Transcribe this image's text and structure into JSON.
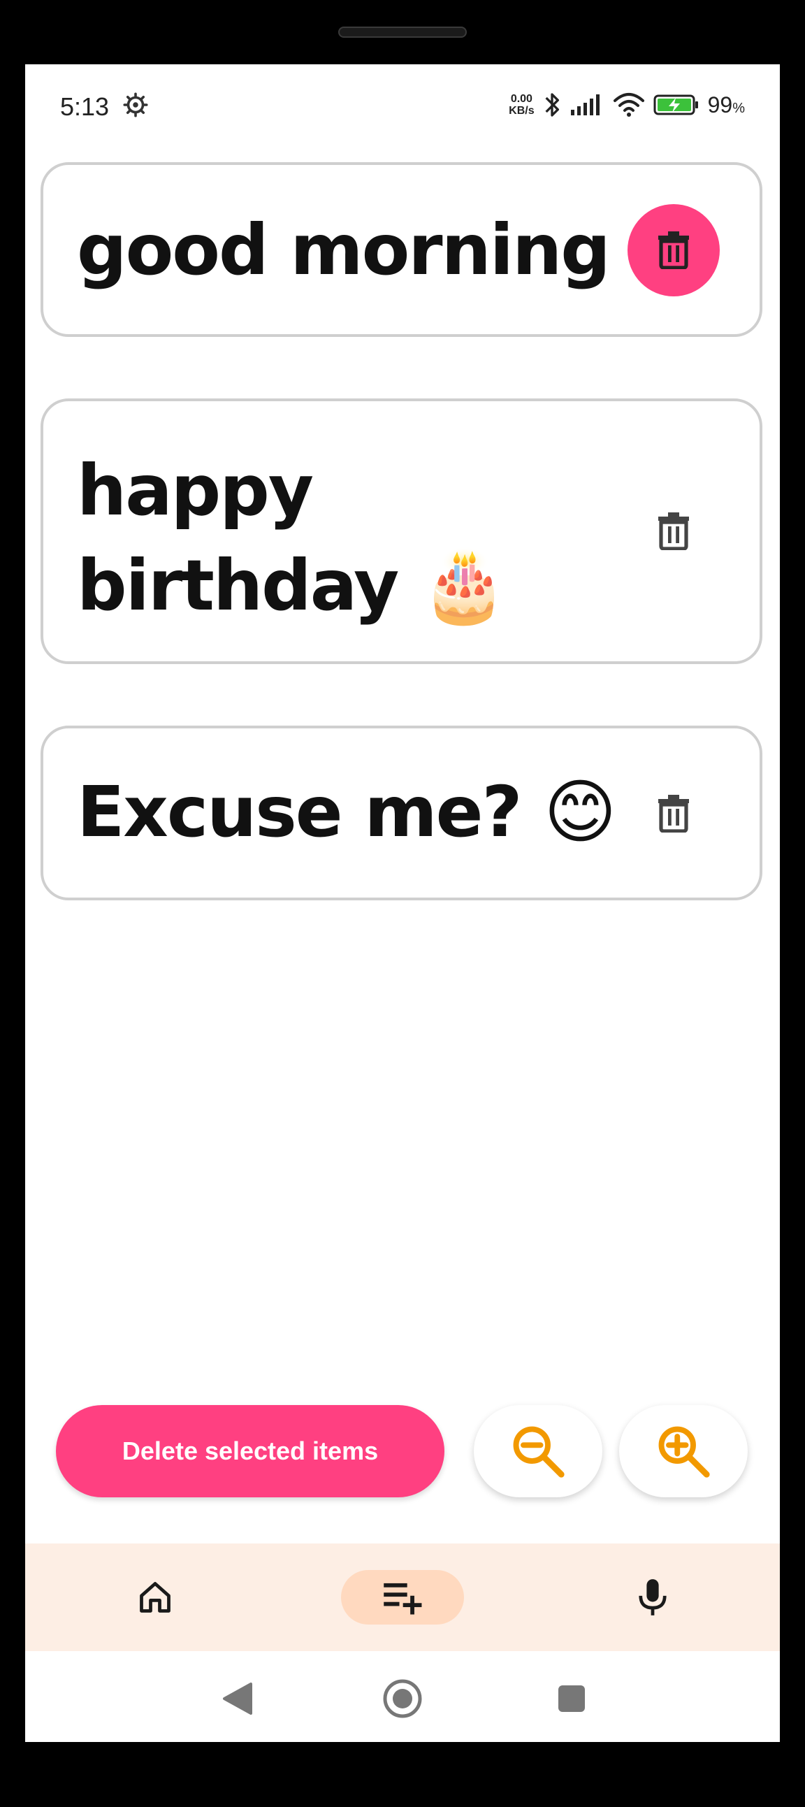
{
  "status_bar": {
    "time": "5:13",
    "net_speed_value": "0.00",
    "net_speed_unit": "KB/s",
    "battery_percent": "99",
    "battery_percent_sign": "%"
  },
  "phrases": [
    {
      "text": "good morning",
      "selected": true
    },
    {
      "text": "happy birthday 🎂",
      "selected": false
    },
    {
      "text": "Excuse me? 😊",
      "selected": false
    }
  ],
  "actions": {
    "delete_selected_label": "Delete selected items",
    "zoom_out_icon": "zoom-out-icon",
    "zoom_in_icon": "zoom-in-icon"
  },
  "bottom_nav": {
    "items": [
      {
        "icon": "home-icon",
        "selected": false
      },
      {
        "icon": "playlist-add-icon",
        "selected": true
      },
      {
        "icon": "microphone-icon",
        "selected": false
      }
    ]
  },
  "colors": {
    "accent_pink": "#ff4081",
    "zoom_icon_orange": "#f29900",
    "nav_background": "#fdeee4",
    "nav_selected": "#ffd9bf"
  }
}
